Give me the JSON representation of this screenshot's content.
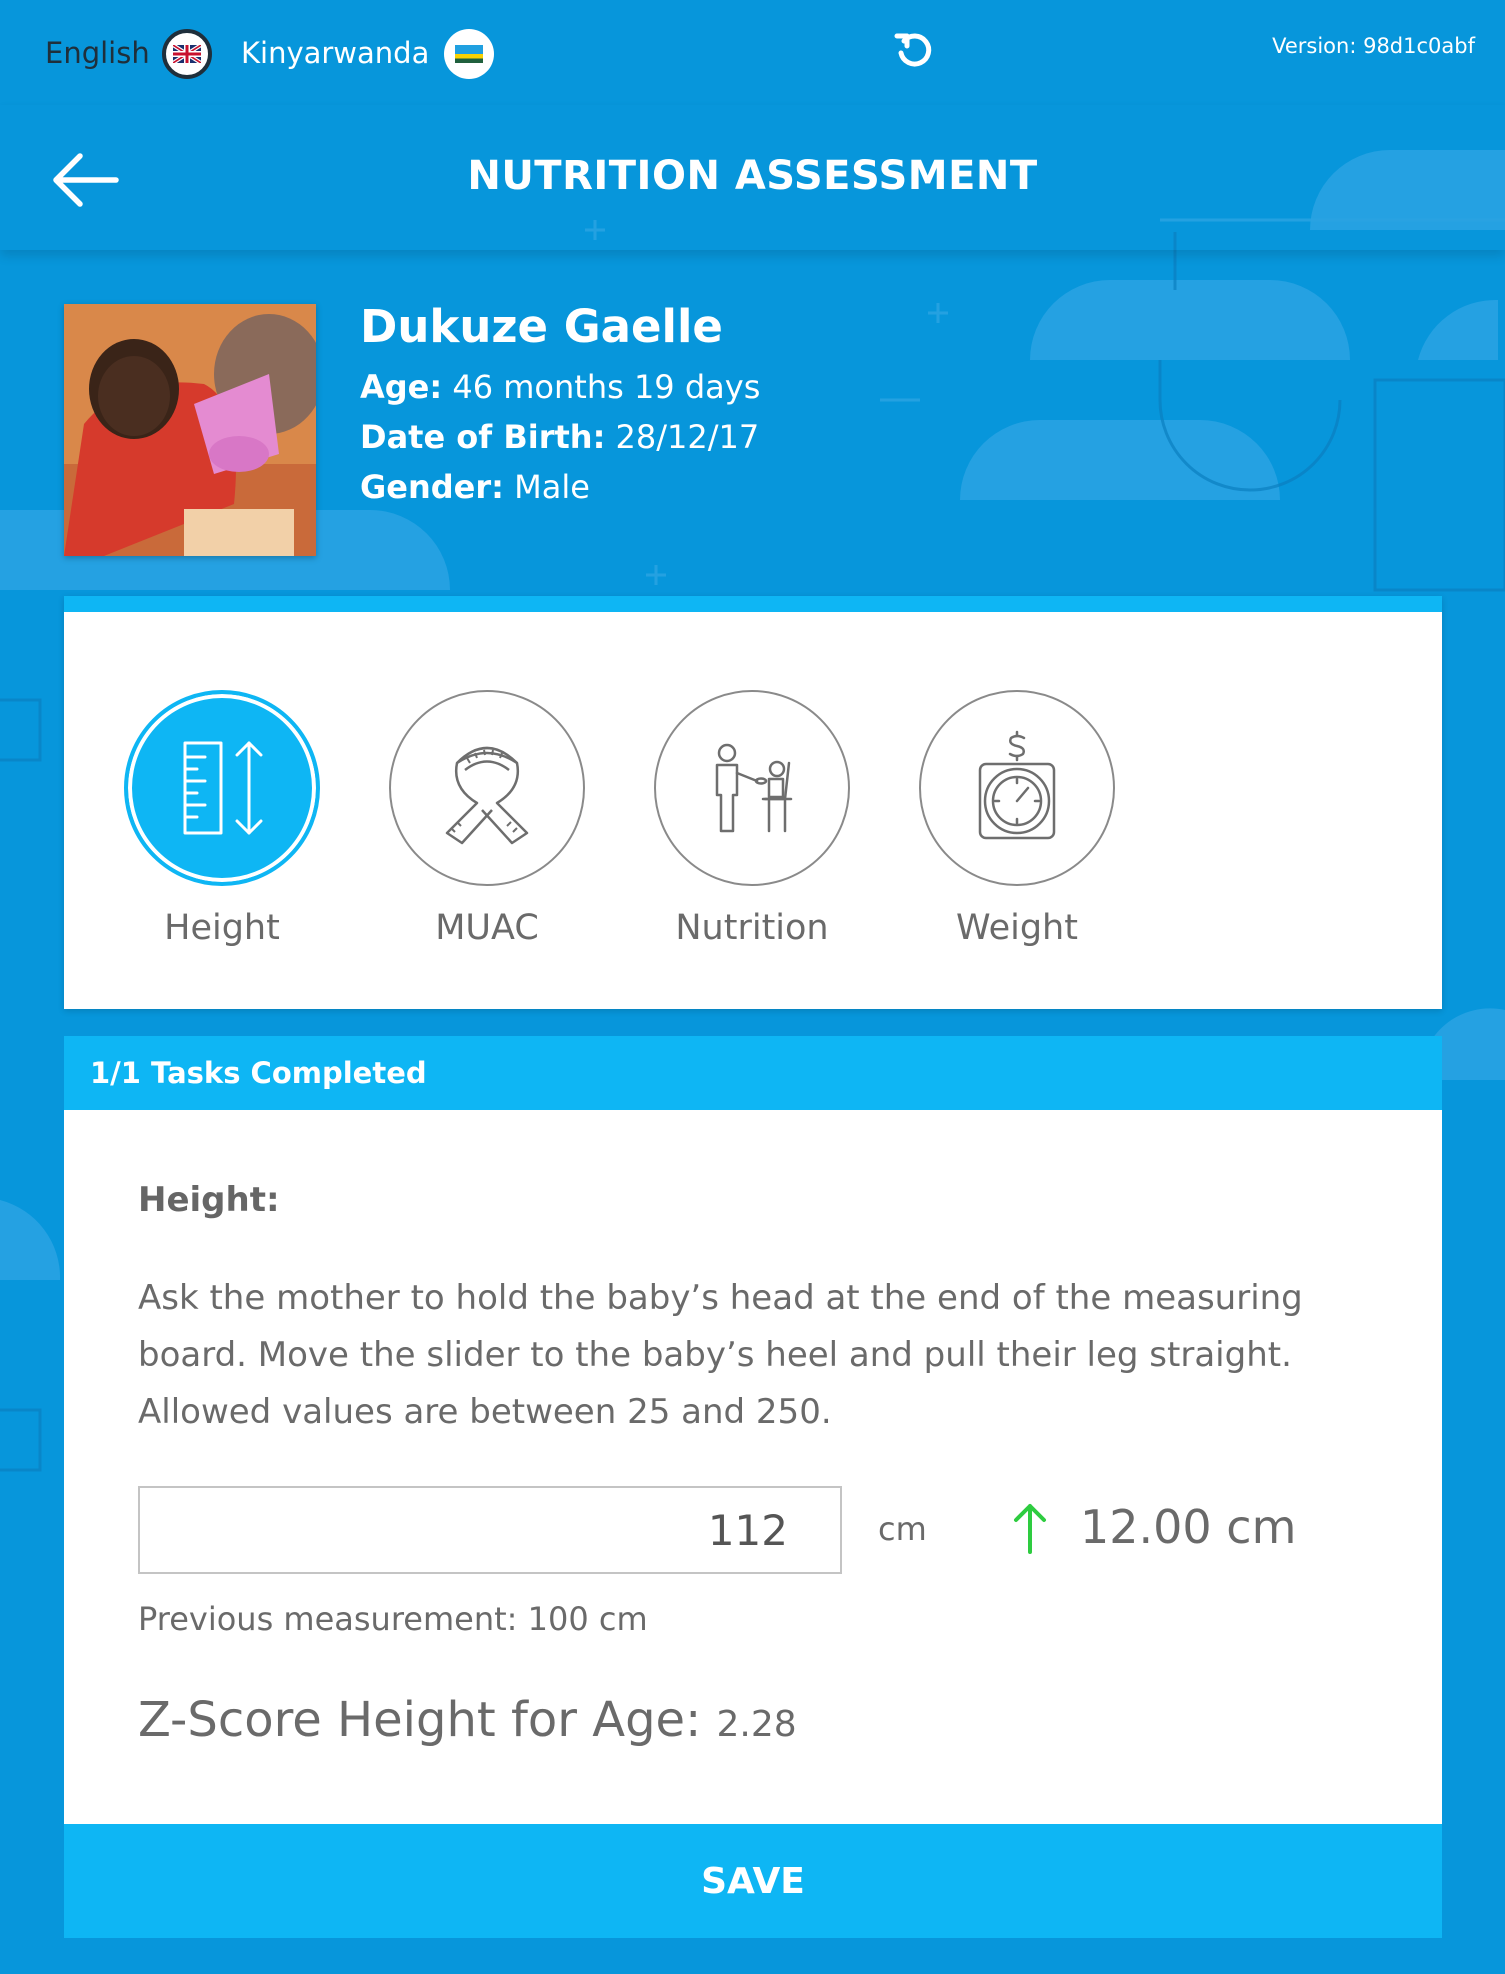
{
  "topbar": {
    "lang_english": "English",
    "lang_kinyarwanda": "Kinyarwanda",
    "version": "Version: 98d1c0abf"
  },
  "header": {
    "title": "NUTRITION ASSESSMENT"
  },
  "patient": {
    "name": "Dukuze Gaelle",
    "age_label": "Age:",
    "age_value": "46 months 19 days",
    "dob_label": "Date of Birth:",
    "dob_value": "28/12/17",
    "gender_label": "Gender:",
    "gender_value": "Male"
  },
  "activities": [
    {
      "label": "Height",
      "icon": "height-ruler-icon",
      "active": true
    },
    {
      "label": "MUAC",
      "icon": "measuring-tape-icon",
      "active": false
    },
    {
      "label": "Nutrition",
      "icon": "feeding-child-icon",
      "active": false
    },
    {
      "label": "Weight",
      "icon": "weight-scale-icon",
      "active": false
    }
  ],
  "tasks": {
    "completed_label": "1/1 Tasks Completed"
  },
  "form": {
    "title": "Height:",
    "instructions": "Ask the mother to hold the baby’s head at the end of the measuring board. Move the slider to the baby’s heel and pull their leg straight.",
    "allowed": "Allowed values are between 25 and 250.",
    "input_value": "112",
    "unit": "cm",
    "change_value": "12.00 cm",
    "previous": "Previous measurement: 100 cm",
    "zscore_label": "Z-Score Height for Age:",
    "zscore_value": "2.28"
  },
  "save_label": "SAVE",
  "colors": {
    "background": "#0796db",
    "accent": "#0eb6f4",
    "change_up": "#2ecc40"
  }
}
